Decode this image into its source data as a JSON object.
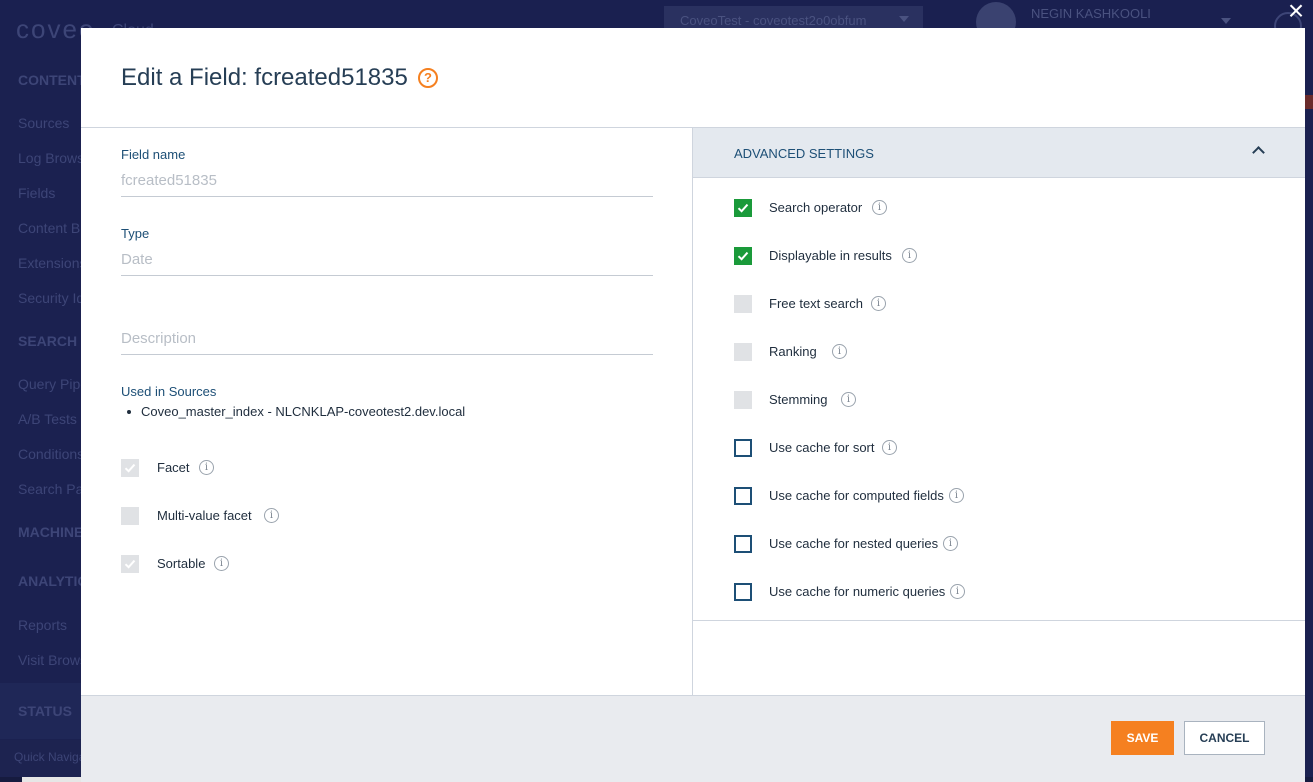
{
  "background": {
    "logo": "coveo",
    "logo_sub": "Cloud",
    "org_selector": "CoveoTest - coveotest2o0obfum",
    "user_name": "NEGIN KASHKOOLI",
    "nav_items": [
      {
        "label": "CONTENT",
        "section": true
      },
      {
        "label": "Sources",
        "section": false
      },
      {
        "label": "Log Browser",
        "section": false
      },
      {
        "label": "Fields",
        "section": false
      },
      {
        "label": "Content Browser",
        "section": false
      },
      {
        "label": "Extensions",
        "section": false
      },
      {
        "label": "Security Identities",
        "section": false
      },
      {
        "label": "SEARCH",
        "section": true
      },
      {
        "label": "Query Pipelines",
        "section": false
      },
      {
        "label": "A/B Tests",
        "section": false
      },
      {
        "label": "Conditions",
        "section": false
      },
      {
        "label": "Search Pages",
        "section": false
      },
      {
        "label": "MACHINE LEARNING",
        "section": true
      },
      {
        "label": "ANALYTICS",
        "section": true
      },
      {
        "label": "Reports",
        "section": false
      },
      {
        "label": "Visit Browser",
        "section": false
      },
      {
        "label": "STATUS",
        "section": true
      },
      {
        "label": "Quick Navigation",
        "section": false
      }
    ]
  },
  "modal": {
    "title": "Edit a Field: fcreated51835",
    "help_glyph": "?",
    "close_glyph": "×",
    "field_name": {
      "label": "Field name",
      "value": "fcreated51835"
    },
    "type": {
      "label": "Type",
      "value": "Date"
    },
    "description": {
      "placeholder": "Description"
    },
    "used_in_sources": {
      "label": "Used in Sources",
      "items": [
        "Coveo_master_index - NLCNKLAP-coveotest2.dev.local"
      ]
    },
    "left_options": [
      {
        "label": "Facet",
        "state": "disabled-checked"
      },
      {
        "label": "Multi-value facet",
        "state": "disabled"
      },
      {
        "label": "Sortable",
        "state": "disabled-checked"
      }
    ],
    "advanced": {
      "title": "ADVANCED SETTINGS",
      "options": [
        {
          "label": "Search operator",
          "state": "checked"
        },
        {
          "label": "Displayable in results",
          "state": "checked"
        },
        {
          "label": "Free text search",
          "state": "disabled"
        },
        {
          "label": "Ranking",
          "state": "disabled"
        },
        {
          "label": "Stemming",
          "state": "disabled"
        },
        {
          "label": "Use cache for sort",
          "state": "empty"
        },
        {
          "label": "Use cache for computed fields",
          "state": "empty"
        },
        {
          "label": "Use cache for nested queries",
          "state": "empty"
        },
        {
          "label": "Use cache for numeric queries",
          "state": "empty"
        }
      ]
    },
    "footer": {
      "save_label": "SAVE",
      "cancel_label": "CANCEL"
    }
  },
  "colors": {
    "accent_orange": "#f58020",
    "check_green": "#1a9a3a",
    "title_navy": "#263e55",
    "label_blue": "#1d4f76",
    "overlay_navy": "#1b2150"
  }
}
